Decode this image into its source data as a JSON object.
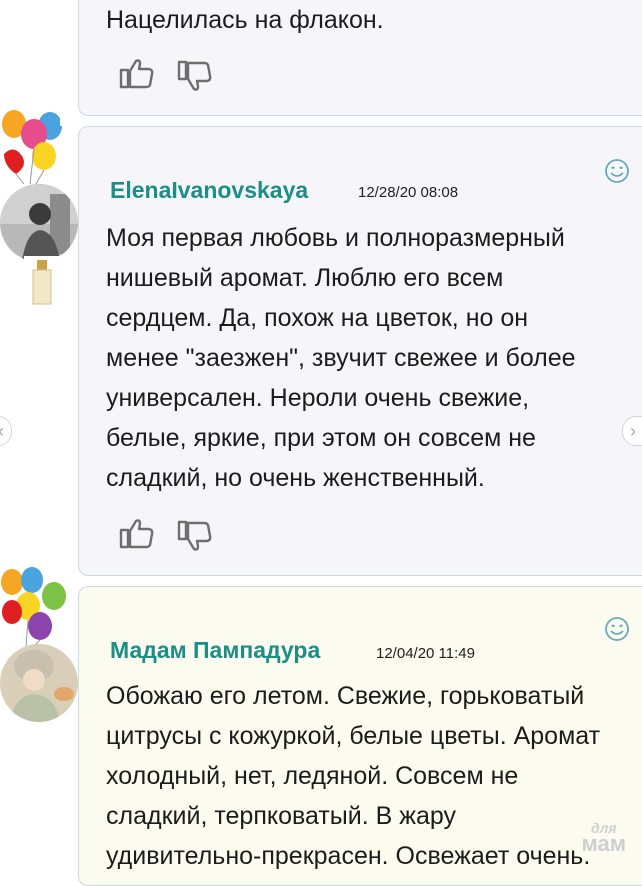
{
  "comments": [
    {
      "text": "Нацелилась на флакон."
    },
    {
      "author": "ElenaIvanovskaya",
      "date": "12/28/20 08:08",
      "lines": [
        "Моя первая любовь и полноразмерный",
        "нишевый аромат. Люблю его всем",
        "сердцем. Да, похож на цветок, но он",
        "менее \"заезжен\", звучит свежее и более",
        "универсален. Нероли очень свежие,",
        "белые, яркие, при этом он совсем не",
        "сладкий, но очень женственный."
      ]
    },
    {
      "author": "Мадам Пампадура",
      "date": "12/04/20 11:49",
      "lines": [
        "Обожаю его летом. Свежие, горьковатый",
        "цитрусы с кожуркой, белые цветы. Аромат",
        "холодный, нет, ледяной. Совсем не",
        "сладкий, терпковатый. В жару",
        "удивительно-прекрасен. Освежает очень."
      ]
    }
  ],
  "watermark": {
    "line1": "для",
    "line2": "мам"
  },
  "icons": {
    "like": "thumbs-up-icon",
    "dislike": "thumbs-down-icon",
    "react": "smiley-icon"
  },
  "colors": {
    "author": "#1b8e86",
    "border": "#c9dbe3",
    "icon": "#6aa9b8"
  }
}
